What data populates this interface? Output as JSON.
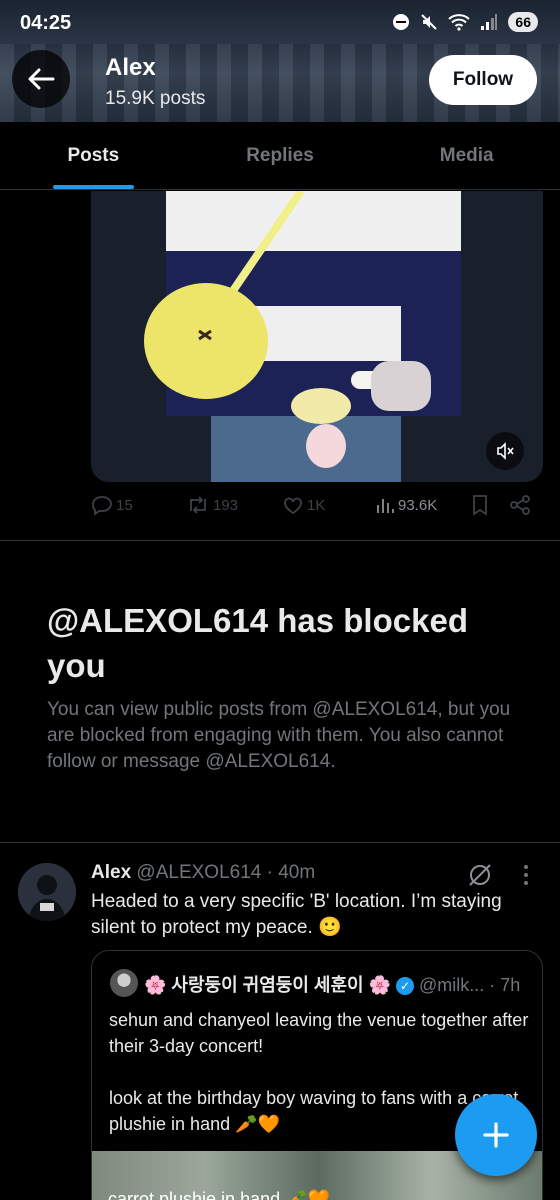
{
  "status_bar": {
    "time": "04:25",
    "battery": "66"
  },
  "header": {
    "name": "Alex",
    "post_count": "15.9K posts",
    "follow_label": "Follow"
  },
  "tabs": [
    {
      "label": "Posts",
      "active": true
    },
    {
      "label": "Replies"
    },
    {
      "label": "Media"
    }
  ],
  "actions": {
    "replies": "15",
    "reposts": "193",
    "likes": "1K",
    "views": "93.6K"
  },
  "blocked": {
    "title": "@ALEXOL614 has blocked you",
    "description": "You can view public posts from @ALEXOL614, but you are blocked from engaging with them. You also cannot follow or message @ALEXOL614."
  },
  "post": {
    "name": "Alex",
    "meta": "@ALEXOL614 · 40m",
    "text": "Headed to a very specific 'B' location. I’m staying silent to protect my peace. 🙂",
    "quote": {
      "name": "🌸 사랑둥이 귀염둥이 세훈이 🌸",
      "meta": "@milk... · 7h",
      "text_line1": "sehun and chanyeol leaving the venue together after their 3-day concert!",
      "text_line2": "look at the birthday boy waving to fans with a carrot plushie in hand 🥕🧡",
      "image_caption": "carrot plushie in hand 🥕🧡"
    }
  },
  "colors": {
    "accent": "#1d9bf0",
    "background": "#000000",
    "muted": "#71767b"
  },
  "icons": [
    "back-arrow-icon",
    "reply-icon",
    "repost-icon",
    "like-icon",
    "views-icon",
    "bookmark-icon",
    "share-icon",
    "mute-icon",
    "grok-icon",
    "more-icon",
    "compose-icon"
  ]
}
